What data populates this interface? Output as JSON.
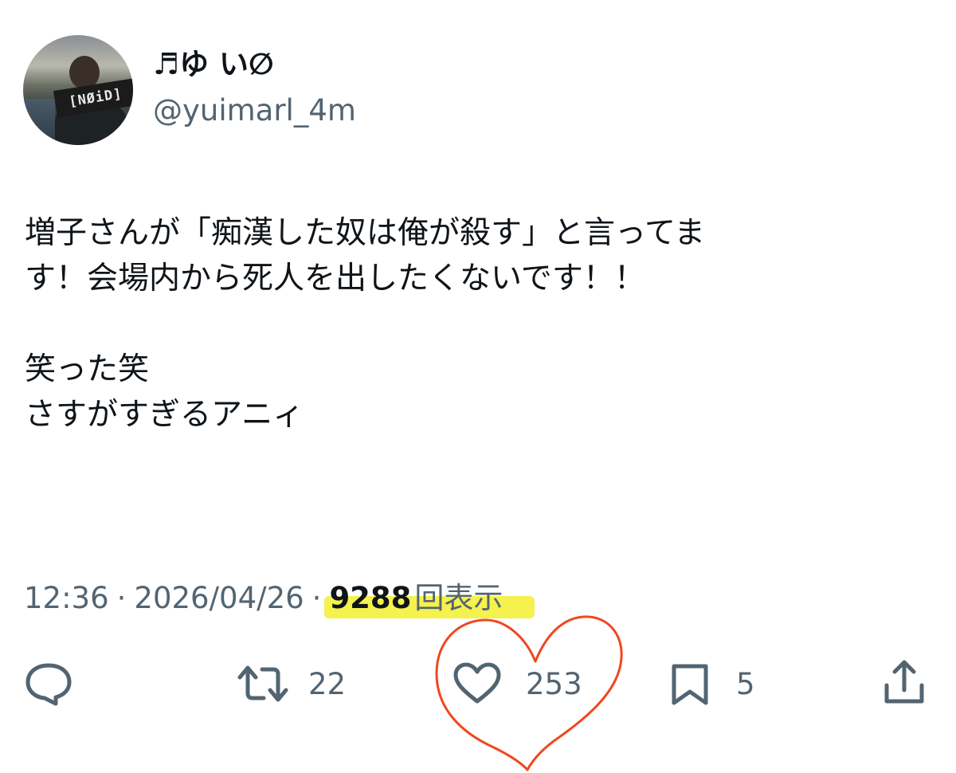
{
  "author": {
    "display_name": "♬ゆ い∅",
    "handle": "@yuimarl_4m",
    "avatar_banner_text": "[NØiD]"
  },
  "tweet": {
    "lines": [
      "増子さんが「痴漢した奴は俺が殺す」と言ってま",
      "す！会場内から死人を出したくないです！！",
      "",
      "笑った笑",
      "さすがすぎるアニィ"
    ]
  },
  "meta": {
    "time": "12:36",
    "separator": "·",
    "date": "2026/04/26",
    "views_count": "9288",
    "views_label": "回表示"
  },
  "actions": {
    "reply_icon": "reply-icon",
    "retweet_icon": "retweet-icon",
    "retweet_count": "22",
    "like_icon": "heart-icon",
    "like_count": "253",
    "bookmark_icon": "bookmark-icon",
    "bookmark_count": "5",
    "share_icon": "share-icon"
  },
  "annotations": {
    "highlight_color": "#f4f03a",
    "drawn_heart_color": "#f0471f"
  }
}
